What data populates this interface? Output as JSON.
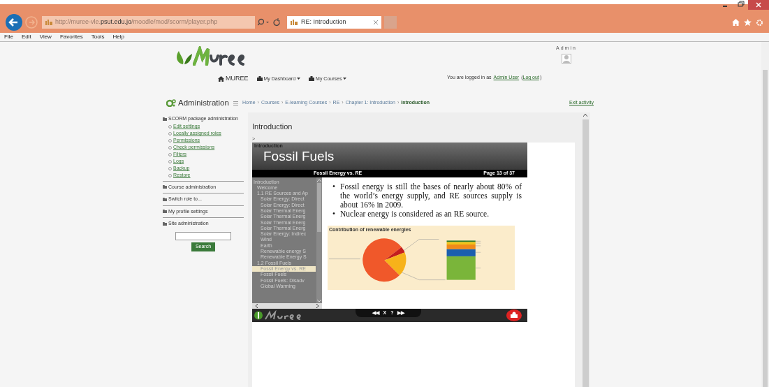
{
  "browser": {
    "url_prefix": "http://muree-vle.",
    "url_host": "psut.edu.jo",
    "url_path": "/moodle/mod/scorm/player.php",
    "tab_title": "RE: Introduction",
    "menu": [
      "File",
      "Edit",
      "View",
      "Favorites",
      "Tools",
      "Help"
    ]
  },
  "header": {
    "user_name": "Admin",
    "nav": [
      "MUREE",
      "My Dashboard",
      "My Courses"
    ],
    "login_text": "You are logged in as",
    "login_user": "Admin User",
    "logout": "Log out",
    "brackets": [
      "(",
      ")"
    ]
  },
  "admin_title": "Administration",
  "breadcrumb_separator": "›",
  "breadcrumb": [
    {
      "label": "Home",
      "current": false
    },
    {
      "label": "Courses",
      "current": false
    },
    {
      "label": "E-learning Courses",
      "current": false
    },
    {
      "label": "RE",
      "current": false
    },
    {
      "label": "Chapter 1: Introduction",
      "current": false
    },
    {
      "label": "Introduction",
      "current": true
    }
  ],
  "exit_link": "Exit activity",
  "sidebar": {
    "sections": [
      {
        "label": "SCORM package administration",
        "children": [
          "Edit settings",
          "Locally assigned roles",
          "Permissions",
          "Check permissions",
          "Filters",
          "Logs",
          "Backup",
          "Restore"
        ]
      },
      {
        "label": "Course administration"
      },
      {
        "label": "Switch role to..."
      },
      {
        "label": "My profile settings"
      },
      {
        "label": "Site administration"
      }
    ],
    "search_button": "Search"
  },
  "content": {
    "title": "Introduction",
    "toggle": ">"
  },
  "slide": {
    "section": "Introduction",
    "title": "Fossil Fuels",
    "subtitle": "Fossil Energy vs. RE",
    "page": "Page 13 of 37",
    "toc": [
      {
        "label": "Introduction",
        "selected": false,
        "children": [
          {
            "label": "Welcome",
            "selected": false
          },
          {
            "label": "1.1 RE Sources and Ap",
            "selected": false,
            "children": [
              {
                "label": "Solar Energy: Direct",
                "selected": false
              },
              {
                "label": "Solar Energy: Direct",
                "selected": false
              },
              {
                "label": "Solar Thermal Energ",
                "selected": false
              },
              {
                "label": "Solar Thermal Energ",
                "selected": false
              },
              {
                "label": "Solar Thermal Energ",
                "selected": false
              },
              {
                "label": "Solar Thermal Energ",
                "selected": false
              },
              {
                "label": "Solar Energy: Indirec",
                "selected": false
              },
              {
                "label": "Wind",
                "selected": false
              },
              {
                "label": "Earth",
                "selected": false
              },
              {
                "label": "Renewable energy S",
                "selected": false
              },
              {
                "label": "Renewable Energy S",
                "selected": false
              }
            ]
          },
          {
            "label": "1.2 Fossil Fuels",
            "selected": false,
            "children": [
              {
                "label": "Fossil Energy vs. RE",
                "selected": true
              },
              {
                "label": "Fossil Fuels",
                "selected": false
              },
              {
                "label": "Fossil Fuels: Disadv",
                "selected": false
              },
              {
                "label": "Global Warming",
                "selected": false
              }
            ]
          }
        ]
      }
    ],
    "bullet": "•",
    "bullets": [
      "Fossil energy is still the bases of nearly about 80% of the world’s energy supply, and RE sources supply is about 16% in 2009.",
      "Nuclear energy is considered as an RE source."
    ],
    "chart_title": "Contribution of renewable energies",
    "controls": [
      "◀◀",
      "X",
      "?",
      "▶▶"
    ]
  }
}
